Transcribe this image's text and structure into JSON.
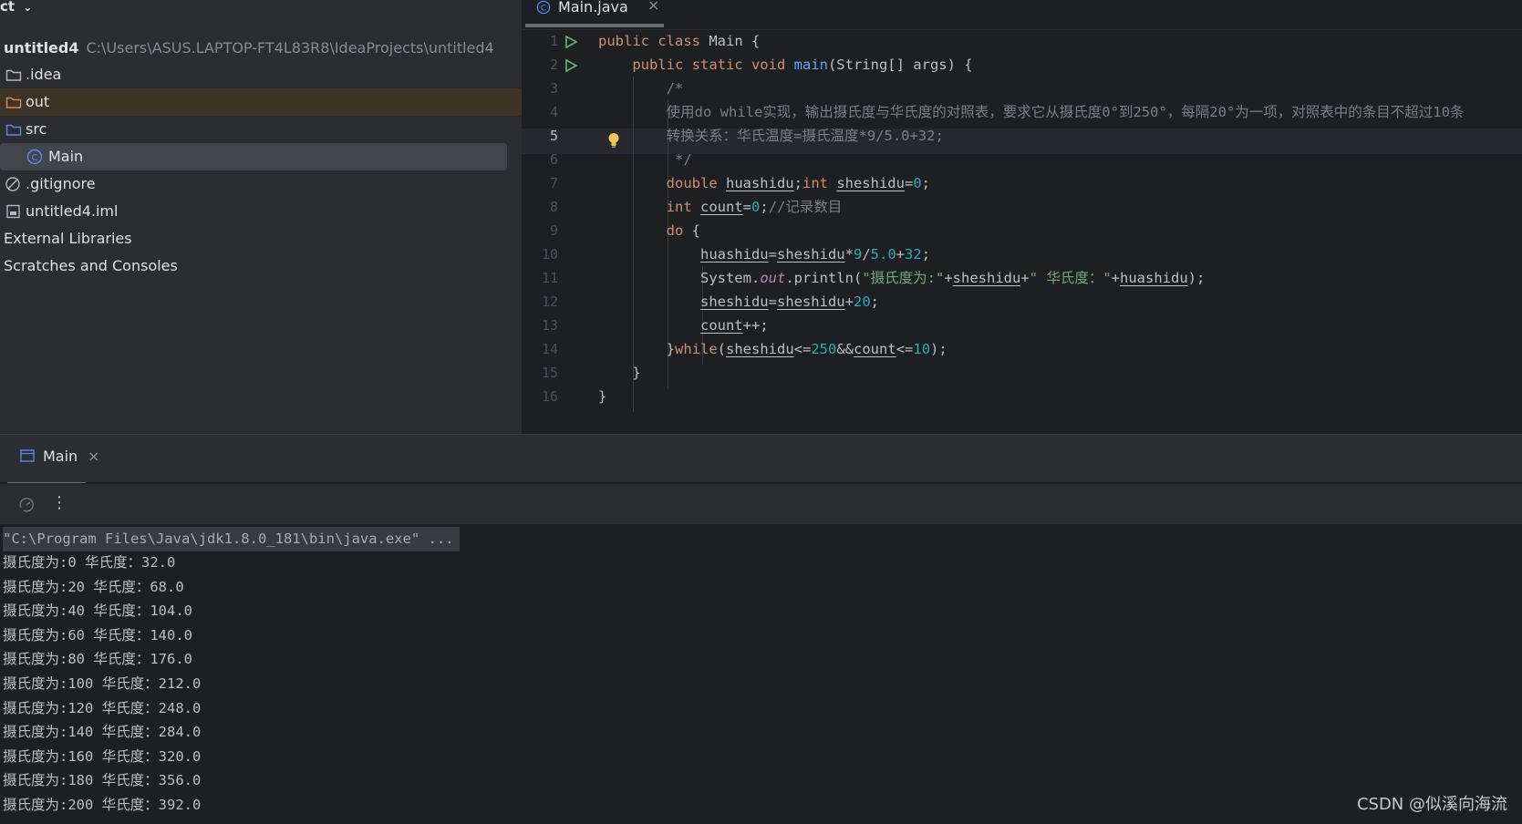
{
  "project": {
    "header": "ct",
    "root_name": "untitled4",
    "root_path": "C:\\Users\\ASUS.LAPTOP-FT4L83R8\\IdeaProjects\\untitled4",
    "items": [
      {
        "label": ".idea"
      },
      {
        "label": "out"
      },
      {
        "label": "src"
      },
      {
        "label": "Main"
      },
      {
        "label": ".gitignore"
      },
      {
        "label": "untitled4.iml"
      },
      {
        "label": "External Libraries"
      },
      {
        "label": "Scratches and Consoles"
      }
    ]
  },
  "editor": {
    "tab_label": "Main.java",
    "tab_close": "×",
    "line_numbers": [
      "1",
      "2",
      "3",
      "4",
      "5",
      "6",
      "7",
      "8",
      "9",
      "10",
      "11",
      "12",
      "13",
      "14",
      "15",
      "16"
    ]
  },
  "run": {
    "tab_label": "Main",
    "tab_close": "×",
    "more": "⋮",
    "command": "\"C:\\Program Files\\Java\\jdk1.8.0_181\\bin\\java.exe\" ...",
    "output": [
      "摄氏度为:0 华氏度：32.0",
      "摄氏度为:20 华氏度：68.0",
      "摄氏度为:40 华氏度：104.0",
      "摄氏度为:60 华氏度：140.0",
      "摄氏度为:80 华氏度：176.0",
      "摄氏度为:100 华氏度：212.0",
      "摄氏度为:120 华氏度：248.0",
      "摄氏度为:140 华氏度：284.0",
      "摄氏度为:160 华氏度：320.0",
      "摄氏度为:180 华氏度：356.0",
      "摄氏度为:200 华氏度：392.0"
    ]
  },
  "watermark": "CSDN @似溪向海流"
}
